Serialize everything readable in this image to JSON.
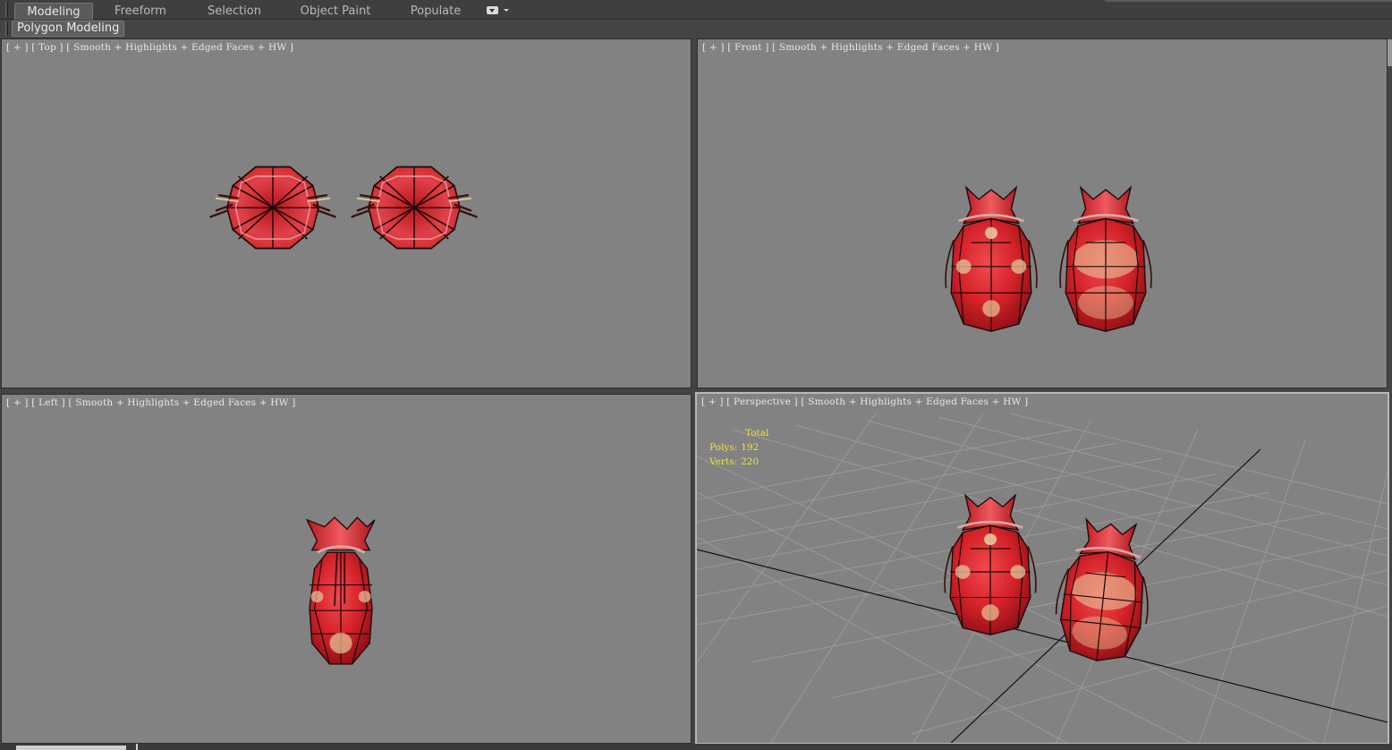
{
  "ribbon": {
    "tabs": [
      {
        "label": "Modeling",
        "active": true
      },
      {
        "label": "Freeform",
        "active": false
      },
      {
        "label": "Selection",
        "active": false
      },
      {
        "label": "Object Paint",
        "active": false
      },
      {
        "label": "Populate",
        "active": false
      }
    ],
    "panel_button": "Polygon Modeling"
  },
  "viewports": {
    "top": {
      "plus": "[ + ]",
      "view": "[ Top ]",
      "shading": "[ Smooth + Highlights + Edged Faces + HW ]"
    },
    "front": {
      "plus": "[ + ]",
      "view": "[ Front ]",
      "shading": "[ Smooth + Highlights + Edged Faces + HW ]"
    },
    "left": {
      "plus": "[ + ]",
      "view": "[ Left ]",
      "shading": "[ Smooth + Highlights + Edged Faces + HW ]"
    },
    "perspective": {
      "plus": "[ + ]",
      "view": "[ Perspective ]",
      "shading": "[ Smooth + Highlights + Edged Faces + HW ]"
    }
  },
  "stats": {
    "header": "Total",
    "polys_label": "Polys:",
    "polys_value": "192",
    "verts_label": "Verts:",
    "verts_value": "220"
  },
  "colors": {
    "viewport_bg": "#828282",
    "ui_bg": "#444444",
    "pouch_red": "#d4242c",
    "pouch_dark": "#8e1015",
    "gold": "#e7c79a",
    "stats_yellow": "#f2e23a"
  },
  "icons": [
    "tab-dropdown-icon"
  ]
}
